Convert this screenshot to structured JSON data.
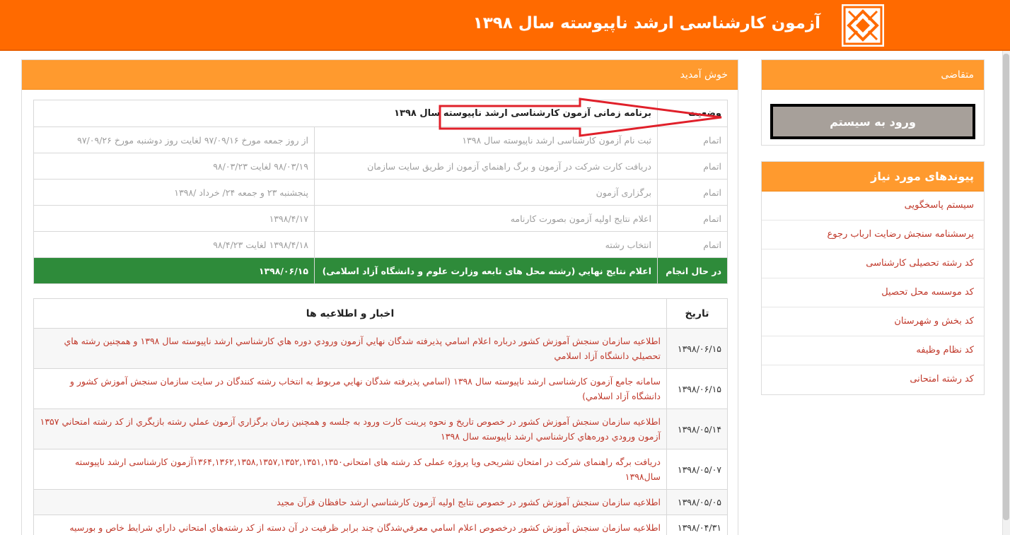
{
  "header": {
    "title": "آزمون کارشناسی ارشد ناپیوسته سال ۱۳۹۸",
    "logo_icon": "sanjesh-logo-icon"
  },
  "colors": {
    "brand": "#ff6a00",
    "panel_header": "#ff9a2e",
    "in_progress": "#2e8b3a",
    "link": "#c0392b"
  },
  "applicant_panel": {
    "title": "متقاضی",
    "login_label": "ورود به سیستم"
  },
  "links_panel": {
    "title": "پیوندهای مورد نیاز",
    "items": [
      "سیستم پاسخگویی",
      "پرسشنامه سنجش رضایت ارباب رجوع",
      "کد رشته تحصیلی کارشناسی",
      "کد موسسه محل تحصیل",
      "کد بخش و شهرستان",
      "کد نظام وظیفه",
      "کد رشته امتحانی"
    ]
  },
  "main_panel": {
    "title": "خوش آمدید"
  },
  "schedule": {
    "status_header": "وضعیت",
    "title_header": "برنامه زمانی آزمون کارشناسی ارشد ناپیوسته سال ۱۳۹۸",
    "rows": [
      {
        "status": "اتمام",
        "title": "ثبت نام آزمون کارشناسی ارشد ناپیوسته سال ۱۳۹۸",
        "date": "از روز جمعه مورخ ۹۷/۰۹/۱۶ لغایت روز دوشنبه مورخ ۹۷/۰۹/۲۶"
      },
      {
        "status": "اتمام",
        "title": "دریافت کارت شرکت در آزمون و برگ راهنماي آزمون از طريق سايت سازمان",
        "date": "۹۸/۰۳/۱۹ لغایت ۹۸/۰۳/۲۳"
      },
      {
        "status": "اتمام",
        "title": "برگزاری آزمون",
        "date": "پنجشنبه ۲۳ و جمعه ۲۴/ خرداد /۱۳۹۸"
      },
      {
        "status": "اتمام",
        "title": "اعلام نتايج اوليه آزمون بصورت کارنامه",
        "date": "۱۳۹۸/۴/۱۷"
      },
      {
        "status": "اتمام",
        "title": "انتخاب رشته",
        "date": "۱۳۹۸/۴/۱۸ لغایت ۹۸/۴/۲۳"
      },
      {
        "status": "در حال انجام",
        "title": "اعلام نتايج نهايي (رشته محل های تابعه وزارت علوم و دانشگاه آزاد اسلامی)",
        "date": "۱۳۹۸/۰۶/۱۵"
      }
    ]
  },
  "news": {
    "date_header": "تاریخ",
    "title_header": "اخبار و اطلاعیه ها",
    "rows": [
      {
        "date": "۱۳۹۸/۰۶/۱۵",
        "text": "اطلاعيه سازمان سنجش آموزش كشور درباره اعلام  اسامي پذيرفته شدگان نهايي آزمون ورودي دوره هاي كارشناسي ارشد ناپيوسته سال ۱۳۹۸ و همچنين رشته هاي تحصيلي دانشگاه آزاد اسلامي"
      },
      {
        "date": "۱۳۹۸/۰۶/۱۵",
        "text": "سامانه جامع آزمون کارشناسی ارشد ناپیوسته سال ۱۳۹۸ (اسامي پذيرفته شدگان نهايي مربوط به انتخاب رشته كنندگان در سايت سازمان سنجش آموزش كشور و دانشگاه آزاد اسلامي)"
      },
      {
        "date": "۱۳۹۸/۰۵/۱۴",
        "text": "اطلاعيه سازمان سنجش آموزش كشور در خصوص تاريخ و نحوه پرينت كارت ورود به جلسه و همچنين زمان برگزاري آزمون عملي رشته بازيگري از كد رشته امتحاني ۱۳۵۷ آزمون ورودي دوره‌هاي كارشناسي ارشد ناپيوسته سال ۱۳۹۸"
      },
      {
        "date": "۱۳۹۸/۰۵/۰۷",
        "text": "دریافت برگه راهنمای شرکت در امتحان تشریحی ویا پروژه عملی کد رشته های امتحانی۱۳۶۴,۱۳۶۲,۱۳۵۸,۱۳۵۷,۱۳۵۲,۱۳۵۱,۱۳۵۰آزمون کارشناسی ارشد ناپیوسته سال۱۳۹۸"
      },
      {
        "date": "۱۳۹۸/۰۵/۰۵",
        "text": "اطلاعيه سازمان سنجش آموزش كشور در خصوص نتايج اوليه آزمون كارشناسي ارشد حافظان قرآن مجيد"
      },
      {
        "date": "۱۳۹۸/۰۴/۳۱",
        "text": "اطلاعيه سازمان سنجش آموزش كشور درخصوص اعلام اسامي معرفي‌شدگان چند برابر ظرفيت در آن دسته از كد رشته‌هاي امتحاني داراي شرايط خاص و بورسيه"
      }
    ]
  }
}
